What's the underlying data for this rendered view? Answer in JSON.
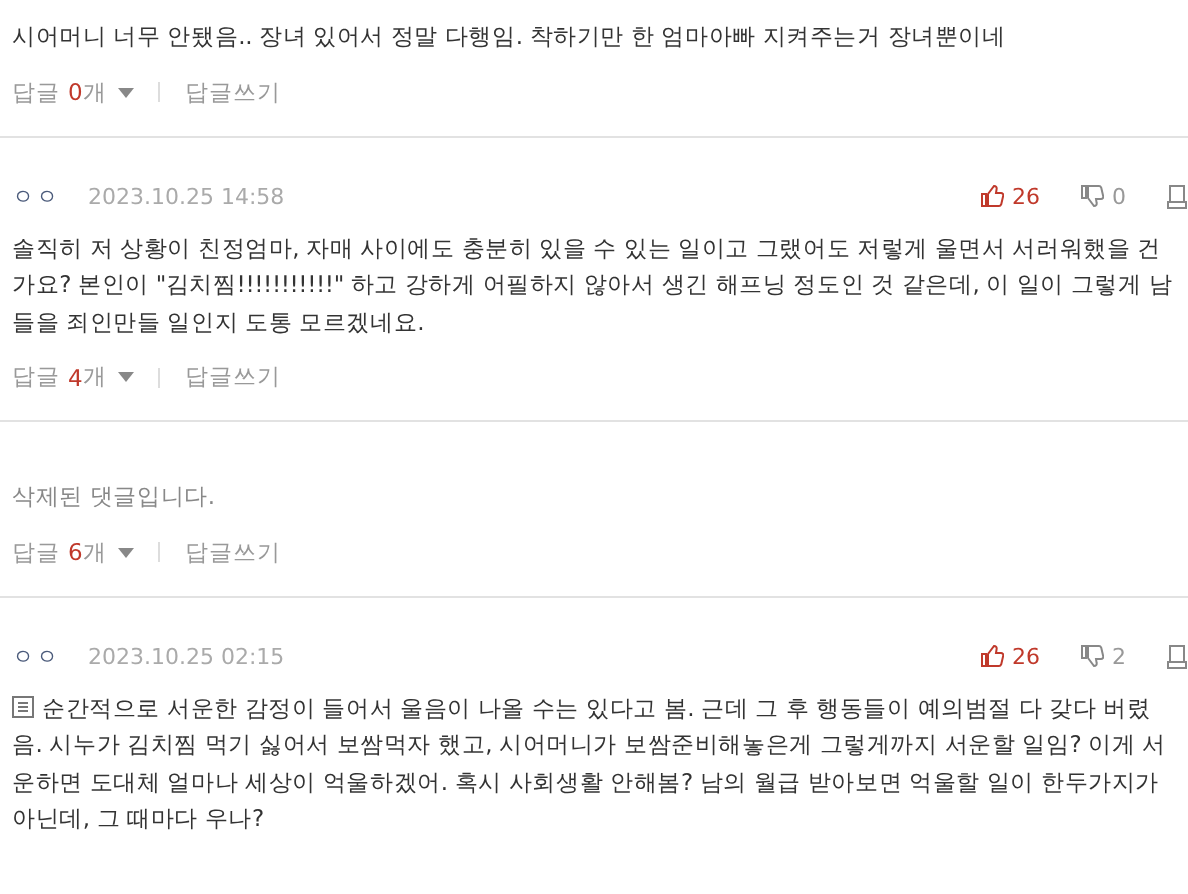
{
  "comments": [
    {
      "kind": "normal",
      "text": "시어머니 너무 안됐음.. 장녀 있어서 정말 다행임. 착하기만 한 엄마아빠 지켜주는거 장녀뿐이네",
      "reply": {
        "label": "답글",
        "count": "0",
        "unit": "개",
        "write": "답글쓰기"
      }
    },
    {
      "kind": "normal",
      "author": "ㅇㅇ",
      "date": "2023.10.25 14:58",
      "likes": "26",
      "dislikes": "0",
      "text": "솔직히 저 상황이 친정엄마, 자매 사이에도 충분히 있을 수 있는 일이고 그랬어도 저렇게 울면서 서러워했을 건가요? 본인이 \"김치찜!!!!!!!!!!!\" 하고 강하게 어필하지 않아서 생긴 해프닝 정도인 것 같은데, 이 일이 그렇게 남들을 죄인만들 일인지 도통 모르겠네요.",
      "reply": {
        "label": "답글",
        "count": "4",
        "unit": "개",
        "write": "답글쓰기"
      }
    },
    {
      "kind": "deleted",
      "text": "삭제된 댓글입니다.",
      "reply": {
        "label": "답글",
        "count": "6",
        "unit": "개",
        "write": "답글쓰기"
      }
    },
    {
      "kind": "normal",
      "author": "ㅇㅇ",
      "date": "2023.10.25 02:15",
      "likes": "26",
      "dislikes": "2",
      "memo": true,
      "text": "순간적으로 서운한 감정이 들어서 울음이 나올 수는 있다고 봄. 근데 그 후 행동들이 예의범절 다 갖다 버렸음. 시누가 김치찜 먹기 싫어서 보쌈먹자 했고, 시어머니가 보쌈준비해놓은게 그렇게까지 서운할 일임? 이게 서운하면 도대체 얼마나 세상이 억울하겠어. 혹시 사회생활 안해봄? 남의 월급 받아보면 억울할 일이 한두가지가 아닌데, 그 때마다 우나?"
    }
  ]
}
